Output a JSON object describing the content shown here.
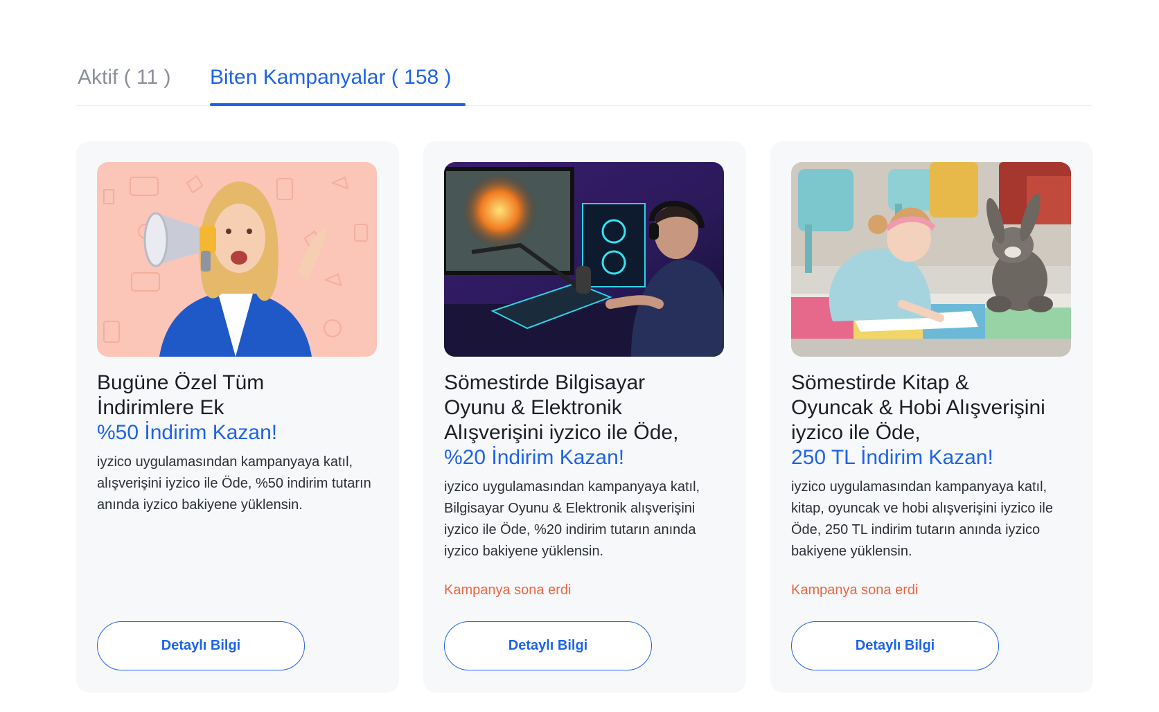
{
  "tabs": [
    {
      "label": "Aktif ( 11 )",
      "active": false
    },
    {
      "label": "Biten Kampanyalar ( 158 )",
      "active": true
    }
  ],
  "cards": [
    {
      "title_line1": "Bugüne Özel Tüm",
      "title_line2": "İndirimlere Ek",
      "title_highlight": "%50 İndirim Kazan!",
      "description": "iyzico uygulamasından kampanyaya katıl, alışverişini iyzico ile Öde, %50 indirim tutarın anında iyzico bakiyene yüklensin.",
      "status": "",
      "button": "Detaylı Bilgi"
    },
    {
      "title_line1": "Sömestirde Bilgisayar",
      "title_line2": "Oyunu & Elektronik",
      "title_line3": "Alışverişini iyzico ile Öde,",
      "title_highlight": "%20 İndirim Kazan!",
      "description": "iyzico uygulamasından kampanyaya katıl, Bilgisayar Oyunu & Elektronik alışverişini iyzico ile Öde,  %20 indirim tutarın anında iyzico bakiyene yüklensin.",
      "status": "Kampanya sona erdi",
      "button": "Detaylı Bilgi"
    },
    {
      "title_line1": "Sömestirde Kitap &",
      "title_line2": "Oyuncak & Hobi Alışverişini",
      "title_line3": "iyzico ile Öde,",
      "title_highlight": "250 TL İndirim Kazan!",
      "description": "iyzico uygulamasından kampanyaya katıl, kitap, oyuncak ve hobi alışverişini iyzico ile Öde, 250 TL indirim tutarın anında iyzico bakiyene yüklensin.",
      "status": "Kampanya sona erdi",
      "button": "Detaylı Bilgi"
    }
  ],
  "colors": {
    "accent": "#1d63ea",
    "ended": "#f0653f",
    "card_bg": "#f7f8fa"
  }
}
